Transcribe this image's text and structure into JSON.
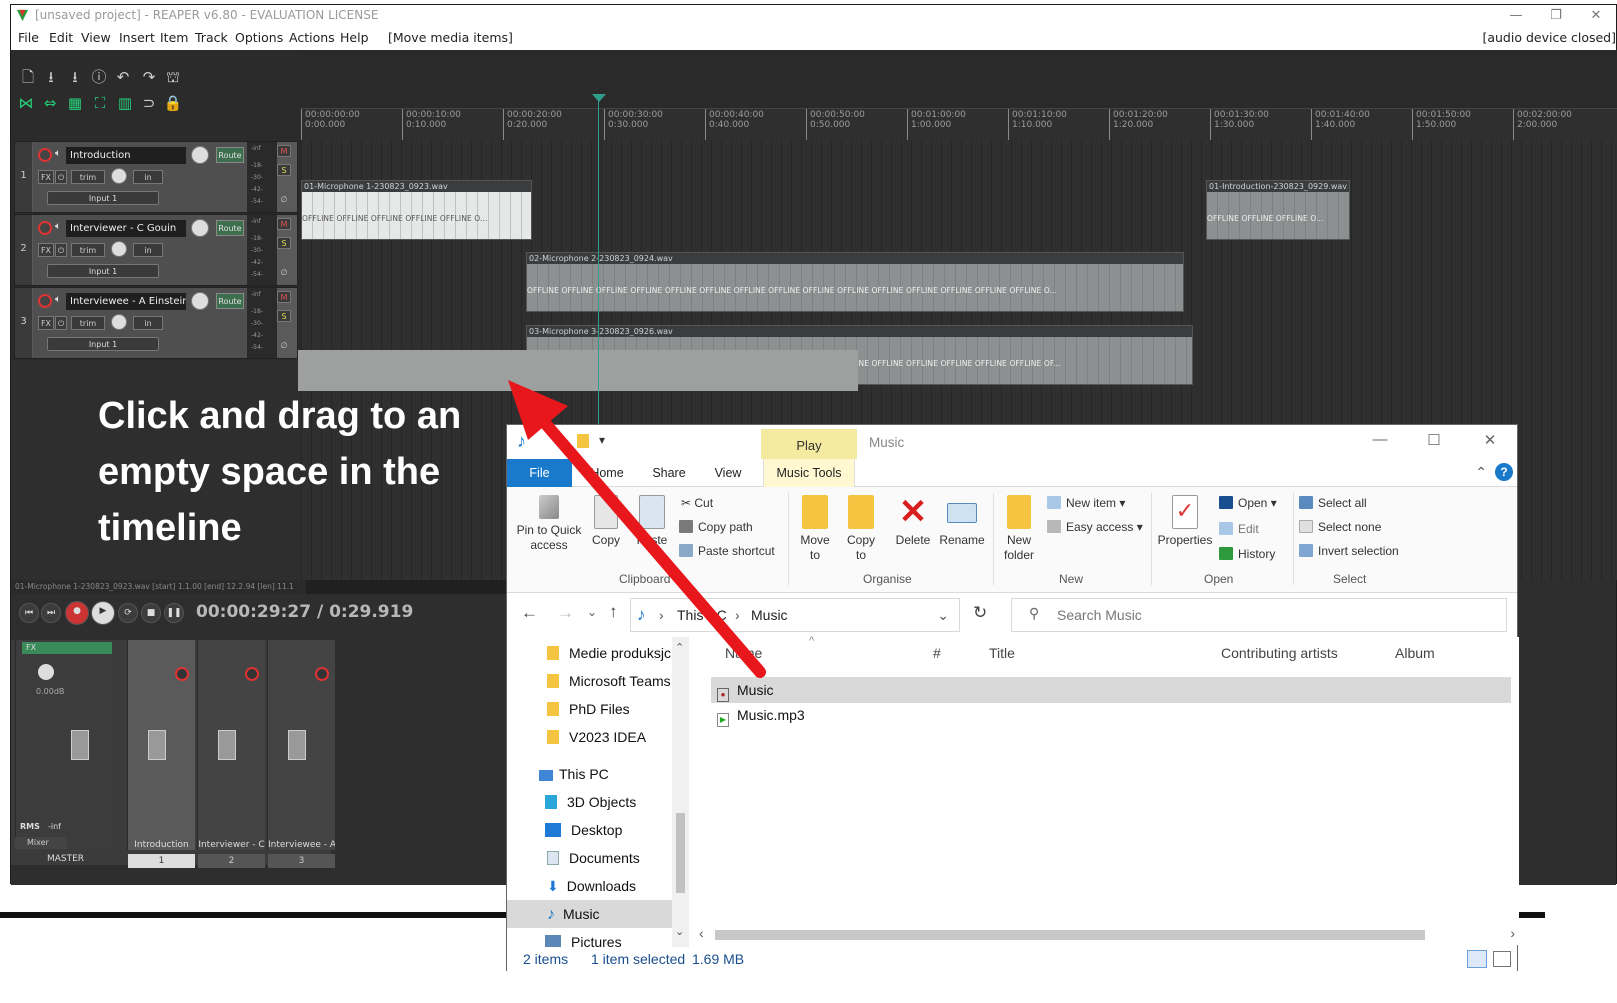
{
  "reaper": {
    "title": "[unsaved project] - REAPER v6.80 - EVALUATION LICENSE",
    "menu": [
      "File",
      "Edit",
      "View",
      "Insert",
      "Item",
      "Track",
      "Options",
      "Actions",
      "Help"
    ],
    "menu_action": "[Move media items]",
    "audio_status": "[audio device closed]",
    "ruler_labels": [
      [
        "00:00:00:00",
        "0:00.000"
      ],
      [
        "00:00:10:00",
        "0:10.000"
      ],
      [
        "00:00:20:00",
        "0:20.000"
      ],
      [
        "00:00:30:00",
        "0:30.000"
      ],
      [
        "00:00:40:00",
        "0:40.000"
      ],
      [
        "00:00:50:00",
        "0:50.000"
      ],
      [
        "00:01:00:00",
        "1:00.000"
      ],
      [
        "00:01:10:00",
        "1:10.000"
      ],
      [
        "00:01:20:00",
        "1:20.000"
      ],
      [
        "00:01:30:00",
        "1:30.000"
      ],
      [
        "00:01:40:00",
        "1:40.000"
      ],
      [
        "00:01:50:00",
        "1:50.000"
      ],
      [
        "00:02:00:00",
        "2:00.000"
      ]
    ],
    "tracks": [
      {
        "number": "1",
        "name": "Introduction",
        "input": "Input 1"
      },
      {
        "number": "2",
        "name": "Interviewer - C Gouin",
        "input": "Input 1"
      },
      {
        "number": "3",
        "name": "Interviewee - A Einstein",
        "input": "Input 1"
      }
    ],
    "route_label": "Route",
    "fx_label": "FX",
    "trim_label": "trim",
    "in_label": "in",
    "meter_scale": [
      "-inf",
      "-18-",
      "-30-",
      "-42-",
      "-54-"
    ],
    "mute_label": "M",
    "solo_label": "S",
    "items": [
      {
        "name": "01-Microphone 1-230823_0923.wav",
        "wave": "OFFLINE  OFFLINE  OFFLINE  OFFLINE  OFFLINE  O..."
      },
      {
        "name": "01-Introduction-230823_0929.wav",
        "wave": "OFFLINE  OFFLINE  OFFLINE  O..."
      },
      {
        "name": "02-Microphone 2-230823_0924.wav",
        "wave": "OFFLINE  OFFLINE  OFFLINE  OFFLINE  OFFLINE  OFFLINE  OFFLINE  OFFLINE  OFFLINE  OFFLINE  OFFLINE  OFFLINE  OFFLINE  OFFLINE  OFFLINE  O..."
      },
      {
        "name": "03-Microphone 3-230823_0926.wav",
        "wave": "OFFLINE  OFFLINE  OFFLINE  OFFLINE  OFFLINE  OFFLINE  OFFLINE  OFFLINE  OFFLINE  OFFLINE  OFFLINE  OFFLINE  OFFLINE  OFFLINE  OFFLINE  OF..."
      }
    ],
    "status_line": "01-Microphone 1-230823_0923.wav [start] 1.1.00 [end] 12.2.94 [len] 11.1",
    "time_display": "00:00:29:27 / 0:29.919",
    "mixer": {
      "master_label": "MASTER",
      "strips": [
        {
          "label": "Introduction",
          "number": "1"
        },
        {
          "label": "Interviewer - C",
          "number": "2"
        },
        {
          "label": "Interviewee - A",
          "number": "3"
        }
      ],
      "master_db": "0.00dB",
      "rms_label": "RMS",
      "inf_label": "-inf",
      "tab_label": "Mixer"
    }
  },
  "instruction": "Click and drag to an empty space in the timeline",
  "explorer": {
    "play_tab": "Play",
    "title": "Music",
    "tabs": {
      "file": "File",
      "home": "Home",
      "share": "Share",
      "view": "View",
      "music_tools": "Music Tools"
    },
    "ribbon": {
      "pin": "Pin to Quick access",
      "copy": "Copy",
      "paste": "Paste",
      "cut": "Cut",
      "copy_path": "Copy path",
      "paste_shortcut": "Paste shortcut",
      "move_to": "Move to",
      "copy_to": "Copy to",
      "delete": "Delete",
      "rename": "Rename",
      "new_folder": "New folder",
      "new_item": "New item",
      "easy_access": "Easy access",
      "properties": "Properties",
      "open": "Open",
      "edit": "Edit",
      "history": "History",
      "select_all": "Select all",
      "select_none": "Select none",
      "invert_selection": "Invert selection",
      "groups": {
        "clipboard": "Clipboard",
        "organise": "Organise",
        "new": "New",
        "open": "Open",
        "select": "Select"
      }
    },
    "address": {
      "this_pc": "This PC",
      "music": "Music"
    },
    "search_placeholder": "Search Music",
    "nav": [
      "Medie produksjc",
      "Microsoft Teams",
      "PhD Files",
      "V2023 IDEA",
      "This PC",
      "3D Objects",
      "Desktop",
      "Documents",
      "Downloads",
      "Music",
      "Pictures"
    ],
    "columns": {
      "name": "Name",
      "number": "#",
      "title": "Title",
      "contributing_artists": "Contributing artists",
      "album": "Album"
    },
    "files": [
      "Music",
      "Music.mp3"
    ],
    "status": {
      "items": "2 items",
      "selected": "1 item selected",
      "size": "1.69 MB"
    }
  },
  "colors": {
    "arrow": "#e8171b",
    "reaper_bg": "#2e2e2e",
    "explorer_accent": "#1979ca",
    "play_tab": "#f5eba0"
  }
}
